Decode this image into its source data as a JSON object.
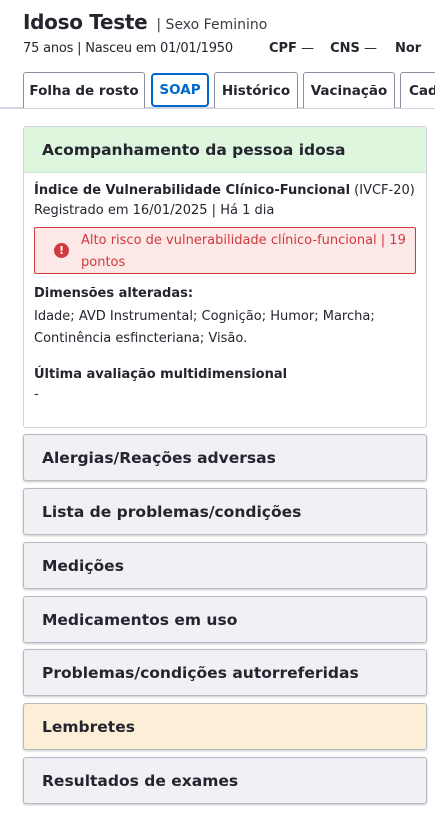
{
  "patient": {
    "name": "Idoso Teste",
    "sex_label": "| Sexo Feminino",
    "age_birth": "75 anos | Nasceu em 01/01/1950",
    "cpf_label": "CPF",
    "cpf_value": "—",
    "cns_label": "CNS",
    "cns_value": "—",
    "nome_social_label": "Nor"
  },
  "tabs": [
    {
      "label": "Folha de rosto",
      "active": false
    },
    {
      "label": "SOAP",
      "active": true
    },
    {
      "label": "Histórico",
      "active": false
    },
    {
      "label": "Vacinação",
      "active": false
    },
    {
      "label": "Cad",
      "active": false
    }
  ],
  "elderly_card": {
    "title": "Acompanhamento da pessoa idosa",
    "index_title": "Índice de Vulnerabilidade Clínico-Funcional",
    "index_abbr": "(IVCF-20)",
    "registered": "Registrado em 16/01/2025 | Há 1 dia",
    "alert_icon": "!",
    "alert_text": "Alto risco de vulnerabilidade clínico-funcional | 19 pontos",
    "dimensions_title": "Dimensões alteradas:",
    "dimensions_text": "Idade; AVD Instrumental; Cognição; Humor; Marcha; Continência esfincteriana; Visão.",
    "last_eval_title": "Última avaliação multidimensional",
    "last_eval_value": "-"
  },
  "sections": [
    {
      "label": "Alergias/Reações adversas"
    },
    {
      "label": "Lista de problemas/condições"
    },
    {
      "label": "Medições"
    },
    {
      "label": "Medicamentos em uso"
    },
    {
      "label": "Problemas/condições autorreferidas"
    },
    {
      "label": "Lembretes"
    },
    {
      "label": "Resultados de exames"
    }
  ],
  "colors": {
    "primary": "#0069d0",
    "danger": "#d0393d",
    "success_bg": "#def5de",
    "reminder_bg": "#fdefd7"
  }
}
